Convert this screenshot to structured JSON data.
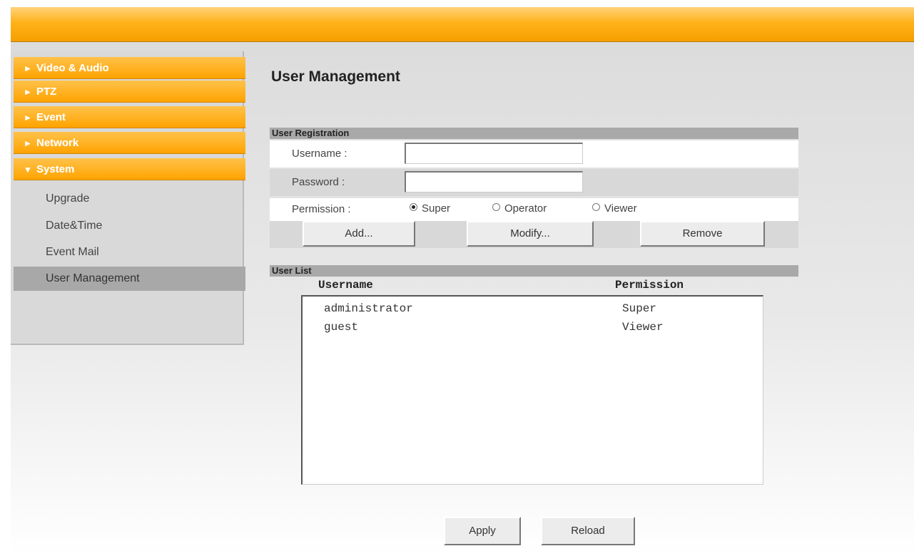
{
  "sidebar": {
    "main_items": [
      {
        "label": "Video & Audio",
        "arrow": "►"
      },
      {
        "label": "PTZ",
        "arrow": "►"
      },
      {
        "label": "Event",
        "arrow": "►"
      },
      {
        "label": "Network",
        "arrow": "►"
      },
      {
        "label": "System",
        "arrow": "▼"
      }
    ],
    "sub_items": [
      {
        "label": "Upgrade"
      },
      {
        "label": "Date&Time"
      },
      {
        "label": "Event Mail"
      },
      {
        "label": "User Management",
        "active": true
      }
    ]
  },
  "main": {
    "title": "User Management",
    "registration": {
      "section_label": "User Registration",
      "username_label": "Username :",
      "username_value": "",
      "password_label": "Password :",
      "password_value": "",
      "permission_label": "Permission :",
      "permission_options": [
        "Super",
        "Operator",
        "Viewer"
      ],
      "permission_selected": "Super",
      "add_label": "Add...",
      "modify_label": "Modify...",
      "remove_label": "Remove"
    },
    "user_list": {
      "section_label": "User List",
      "columns": [
        "Username",
        "Permission"
      ],
      "rows": [
        {
          "username": "administrator",
          "permission": "Super"
        },
        {
          "username": "guest",
          "permission": "Viewer"
        }
      ]
    },
    "apply_label": "Apply",
    "reload_label": "Reload"
  }
}
